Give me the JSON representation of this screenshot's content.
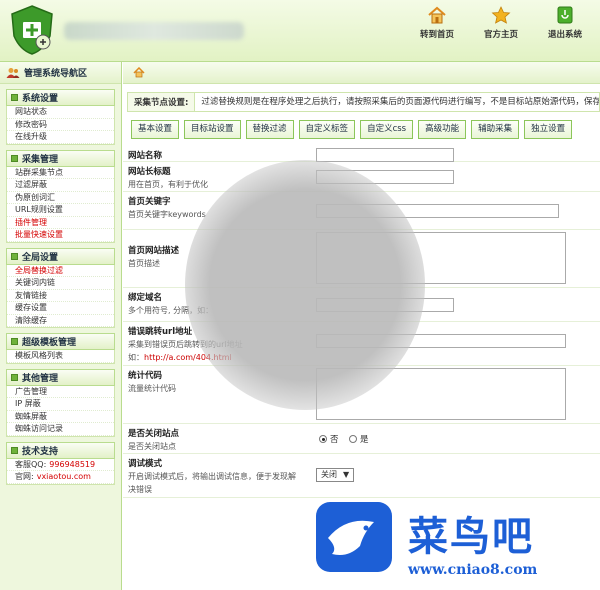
{
  "header": {
    "nav": [
      {
        "label": "转到首页",
        "icon": "home-icon"
      },
      {
        "label": "官方主页",
        "icon": "star-icon"
      },
      {
        "label": "退出系统",
        "icon": "exit-icon"
      }
    ]
  },
  "sidebar": {
    "title": "管理系统导航区",
    "groups": [
      {
        "title": "系统设置",
        "items": [
          {
            "label": "网站状态"
          },
          {
            "label": "修改密码"
          },
          {
            "label": "在线升级"
          }
        ]
      },
      {
        "title": "采集管理",
        "items": [
          {
            "label": "站群采集节点"
          },
          {
            "label": "过滤屏蔽"
          },
          {
            "label": "伪原创词汇"
          },
          {
            "label": "URL规则设置"
          },
          {
            "label": "插件管理",
            "red": true
          },
          {
            "label": "批量快速设置",
            "red": true
          }
        ]
      },
      {
        "title": "全局设置",
        "items": [
          {
            "label": "全局替换过滤",
            "red": true
          },
          {
            "label": "关键词内链"
          },
          {
            "label": "友情链接"
          },
          {
            "label": "缓存设置"
          },
          {
            "label": "清除缓存"
          }
        ]
      },
      {
        "title": "超级模板管理",
        "items": [
          {
            "label": "模板风格列表"
          }
        ]
      },
      {
        "title": "其他管理",
        "items": [
          {
            "label": "广告管理"
          },
          {
            "label": "IP 屏蔽"
          },
          {
            "label": "蜘蛛屏蔽"
          },
          {
            "label": "蜘蛛访问记录"
          }
        ]
      },
      {
        "title": "技术支持",
        "items": [
          {
            "label": "客服QQ:",
            "value": "996948519"
          },
          {
            "label": "官网:",
            "value": "vxiaotou.com"
          }
        ]
      }
    ]
  },
  "main": {
    "notice_label": "采集节点设置:",
    "notice_text": "过滤替换规则是在程序处理之后执行，请按照采集后的页面源代码进行编写，不是目标站原始源代码，保存后",
    "tabs": [
      "基本设置",
      "目标站设置",
      "替换过滤",
      "自定义标签",
      "自定义css",
      "高级功能",
      "辅助采集",
      "独立设置"
    ],
    "fields": {
      "site_name": {
        "title": "网站名称"
      },
      "site_title": {
        "title": "网站长标题",
        "desc": "用在首页，有利于优化"
      },
      "keywords": {
        "title": "首页关键字",
        "desc": "首页关键字keywords"
      },
      "description": {
        "title": "首页网站描述",
        "desc": "首页描述"
      },
      "domain": {
        "title": "绑定域名",
        "desc": "多个用符号, 分隔，如："
      },
      "error_url": {
        "title": "错误跳转url地址",
        "desc": "采集到错误页后跳转到的url地址",
        "example_prefix": "如：",
        "example": "http://a.com/404.html"
      },
      "stats": {
        "title": "统计代码",
        "desc": "流量统计代码"
      },
      "close_site": {
        "title": "是否关闭站点",
        "desc": "是否关闭站点",
        "no": "否",
        "yes": "是"
      },
      "debug": {
        "title": "调试模式",
        "desc1": "开启调试模式后，将输出调试信息，便于发现解",
        "desc2": "决错误",
        "value": "关闭"
      }
    }
  },
  "watermark": {
    "brand": "菜鸟吧",
    "url": "www.cniao8.com"
  },
  "colors": {
    "accent_green": "#6fb23b",
    "watermark_blue": "#1d5fd6",
    "highlight_red": "#d40000"
  }
}
